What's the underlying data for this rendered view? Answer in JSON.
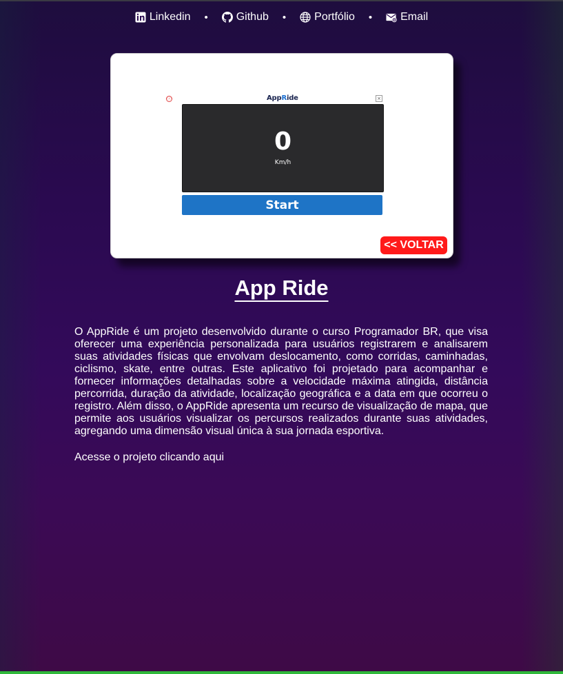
{
  "nav": {
    "items": [
      {
        "label": "Linkedin",
        "icon": "linkedin-icon"
      },
      {
        "label": "Github",
        "icon": "github-icon"
      },
      {
        "label": "Portfólio",
        "icon": "globe-icon"
      },
      {
        "label": "Email",
        "icon": "envelope-icon"
      }
    ],
    "separator": "•"
  },
  "preview": {
    "ad_info": "ⓘ",
    "ad_close": "×",
    "logo_prefix": "App",
    "logo_r": "R",
    "logo_suffix": "ide",
    "speed_value": "0",
    "speed_unit": "Km/h",
    "start_label": "Start",
    "back_label": "<< VOLTAR"
  },
  "project": {
    "title": "App Ride",
    "description": "O AppRide é um projeto desenvolvido durante o curso Programador BR, que visa oferecer uma experiência personalizada para usuários registrarem e analisarem suas atividades físicas que envolvam deslocamento, como corridas, caminhadas, ciclismo, skate, entre outras. Este aplicativo foi projetado para acompanhar e fornecer informações detalhadas sobre a velocidade máxima atingida, distância percorrida, duração da atividade, localização geográfica e a data em que ocorreu o registro. Além disso, o AppRide apresenta um recurso de visualização de mapa, que permite aos usuários visualizar os percursos realizados durante suas atividades, agregando uma dimensão visual única à sua jornada esportiva.",
    "access_prefix": "Acesse o projeto",
    "access_link": "clicando aqui"
  },
  "colors": {
    "background_top": "#1e0d3e",
    "background_bottom": "#3e0a46",
    "back_button": "#ff1a1a",
    "start_button": "#1e74c6",
    "bottom_bar": "#2fb83a"
  }
}
